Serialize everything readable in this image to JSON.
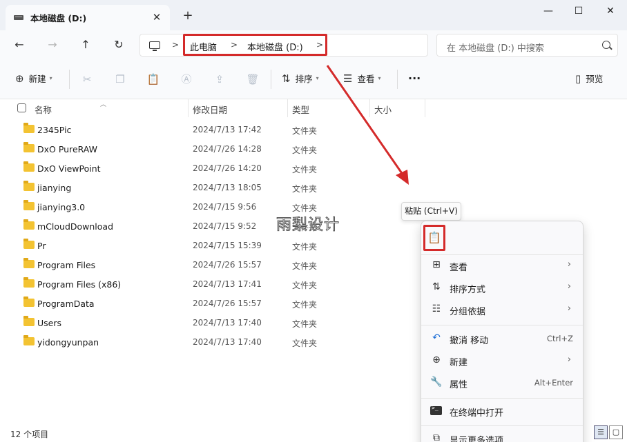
{
  "window": {
    "tab_title": "本地磁盘 (D:)",
    "tab_close": "✕",
    "new_tab": "+",
    "minimize": "—",
    "maximize": "☐",
    "close": "✕"
  },
  "nav": {
    "back": "←",
    "forward": "→",
    "up": "↑",
    "refresh": "↻"
  },
  "address": {
    "chevrons": [
      ">",
      ">",
      ">"
    ],
    "crumbs": [
      "此电脑",
      "本地磁盘 (D:)"
    ]
  },
  "search": {
    "placeholder": "在 本地磁盘 (D:) 中搜索"
  },
  "toolbar": {
    "new_label": "新建",
    "sort_label": "排序",
    "view_label": "查看",
    "more_label": "···",
    "preview_label": "预览"
  },
  "columns": {
    "name": "名称",
    "modified": "修改日期",
    "type": "类型",
    "size": "大小"
  },
  "files": [
    {
      "name": "2345Pic",
      "date": "2024/7/13 17:42",
      "type": "文件夹"
    },
    {
      "name": "DxO PureRAW",
      "date": "2024/7/26 14:28",
      "type": "文件夹"
    },
    {
      "name": "DxO ViewPoint",
      "date": "2024/7/26 14:20",
      "type": "文件夹"
    },
    {
      "name": "jianying",
      "date": "2024/7/13 18:05",
      "type": "文件夹"
    },
    {
      "name": "jianying3.0",
      "date": "2024/7/15 9:56",
      "type": "文件夹"
    },
    {
      "name": "mCloudDownload",
      "date": "2024/7/15 9:52",
      "type": "文件夹"
    },
    {
      "name": "Pr",
      "date": "2024/7/15 15:39",
      "type": "文件夹"
    },
    {
      "name": "Program Files",
      "date": "2024/7/26 15:57",
      "type": "文件夹"
    },
    {
      "name": "Program Files (x86)",
      "date": "2024/7/13 17:41",
      "type": "文件夹"
    },
    {
      "name": "ProgramData",
      "date": "2024/7/26 15:57",
      "type": "文件夹"
    },
    {
      "name": "Users",
      "date": "2024/7/13 17:40",
      "type": "文件夹"
    },
    {
      "name": "yidongyunpan",
      "date": "2024/7/13 17:40",
      "type": "文件夹"
    }
  ],
  "status": {
    "item_count": "12 个项目"
  },
  "watermark": "雨梨设计",
  "tooltip": "粘贴 (Ctrl+V)",
  "context_menu": {
    "items": [
      {
        "label": "查看",
        "shortcut": ""
      },
      {
        "label": "排序方式",
        "shortcut": ""
      },
      {
        "label": "分组依据",
        "shortcut": ""
      },
      {
        "label": "撤消 移动",
        "shortcut": "Ctrl+Z"
      },
      {
        "label": "新建",
        "shortcut": ""
      },
      {
        "label": "属性",
        "shortcut": "Alt+Enter"
      },
      {
        "label": "在终端中打开",
        "shortcut": ""
      },
      {
        "label": "显示更多选项",
        "shortcut": ""
      }
    ]
  },
  "colors": {
    "annotation_red": "#d42a2a",
    "folder_yellow": "#f3c332",
    "chrome_bg": "#eef1f6"
  }
}
